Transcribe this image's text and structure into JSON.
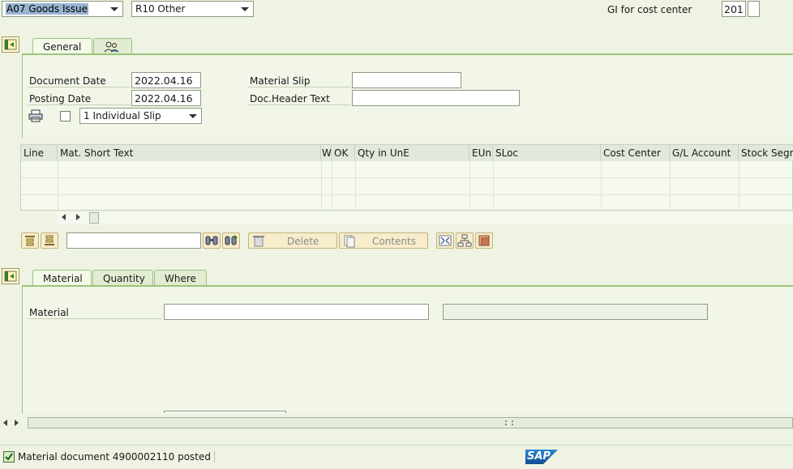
{
  "header": {
    "transaction": "A07 Goods Issue",
    "movement": "R10 Other",
    "gi_label": "GI for cost center",
    "movement_type": "201"
  },
  "header_tabs": [
    {
      "label": "General",
      "active": true
    },
    {
      "label": "",
      "icon": "partner-icon"
    }
  ],
  "general": {
    "document_date_label": "Document Date",
    "document_date": "2022.04.16",
    "posting_date_label": "Posting Date",
    "posting_date": "2022.04.16",
    "material_slip_label": "Material Slip",
    "material_slip": "",
    "doc_header_label": "Doc.Header Text",
    "doc_header": "",
    "print_version": "1 Individual Slip"
  },
  "items_table": {
    "columns": [
      "Line",
      "Mat. Short Text",
      "W",
      "OK",
      "Qty in UnE",
      "EUn",
      "SLoc",
      "Cost Center",
      "G/L Account",
      "Stock Segm"
    ],
    "rows": [
      [],
      [],
      []
    ]
  },
  "toolbar": {
    "delete_label": "Delete",
    "contents_label": "Contents",
    "search_value": ""
  },
  "detail_tabs": [
    {
      "label": "Material",
      "active": true
    },
    {
      "label": "Quantity",
      "active": false
    },
    {
      "label": "Where",
      "active": false
    }
  ],
  "detail": {
    "material_label": "Material",
    "material_value": "",
    "material_desc": ""
  },
  "status": {
    "message": "Material document 4900002110 posted",
    "type": "success"
  },
  "brand": {
    "logo": "SAP",
    "accent": "#9bc47a",
    "logo_color": "#1d6fbf"
  }
}
